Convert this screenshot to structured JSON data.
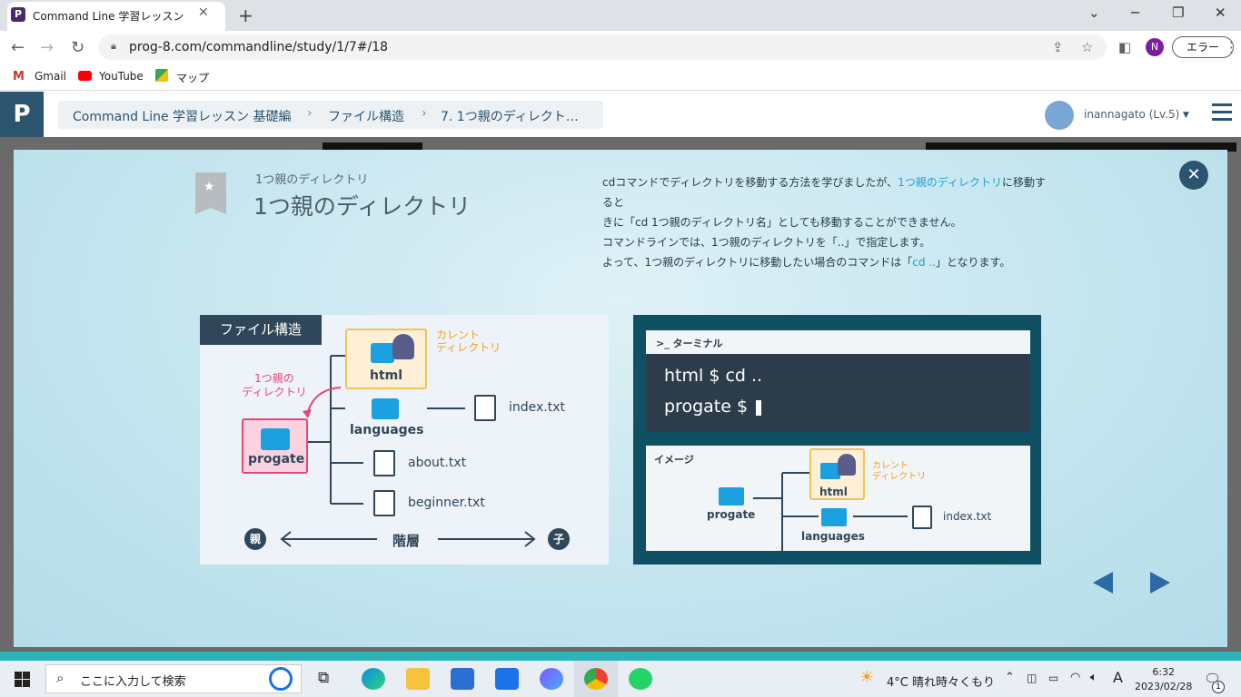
{
  "browser": {
    "tab_title": "Command Line 学習レッスン 基礎編",
    "favicon_letter": "P",
    "url": "prog-8.com/commandline/study/1/7#/18",
    "profile_initial": "N",
    "error_label": "エラー"
  },
  "bookmarks": [
    {
      "label": "Gmail"
    },
    {
      "label": "YouTube"
    },
    {
      "label": "マップ"
    }
  ],
  "header": {
    "breadcrumb": [
      "Command Line 学習レッスン 基礎編",
      "ファイル構造",
      "7. 1つ親のディレクト…"
    ],
    "username": "inannagato (Lv.5)"
  },
  "slide": {
    "subtitle": "1つ親のディレクトリ",
    "title": "1つ親のディレクトリ",
    "desc": {
      "l1a": "cdコマンドでディレクトリを移動する方法を学びましたが、",
      "l1b": "1つ親のディレクトリ",
      "l1c": "に移動すると",
      "l2": "きに「cd 1つ親のディレクトリ名」としても移動することができません。",
      "l3": "コマンドラインでは、1つ親のディレクトリを「..」で指定します。",
      "l4a": "よって、1つ親のディレクトリに移動したい場合のコマンドは「",
      "l4b": "cd ..",
      "l4c": "」となります。"
    }
  },
  "diagram_left": {
    "tag": "ファイル構造",
    "current_label_1": "カレント",
    "current_label_2": "ディレクトリ",
    "parent_label_1": "1つ親の",
    "parent_label_2": "ディレクトリ",
    "html": "html",
    "languages": "languages",
    "index": "index.txt",
    "progate": "progate",
    "about": "about.txt",
    "beginner": "beginner.txt",
    "parent_kanji": "親",
    "child_kanji": "子",
    "hierarchy": "階層"
  },
  "diagram_right": {
    "terminal_label": "ターミナル",
    "line1": "html $ cd ..",
    "line2": "progate $",
    "image_label": "イメージ",
    "html": "html",
    "current_label_1": "カレント",
    "current_label_2": "ディレクトリ",
    "progate": "progate",
    "languages": "languages",
    "index": "index.txt"
  },
  "taskbar": {
    "search_placeholder": "ここに入力して検索",
    "weather": "4°C  晴れ時々くもり",
    "ime": "A",
    "time": "6:32",
    "date": "2023/02/28",
    "notifications": "1"
  }
}
